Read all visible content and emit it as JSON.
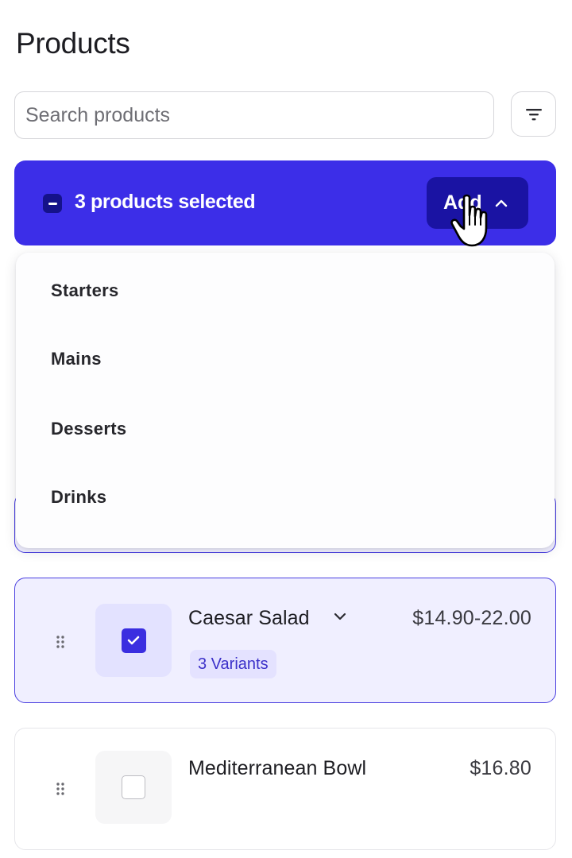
{
  "page": {
    "title": "Products"
  },
  "search": {
    "placeholder": "Search products",
    "value": ""
  },
  "filter": {
    "icon": "filter-icon"
  },
  "selection_bar": {
    "text": "3 products selected",
    "add_label": "Add",
    "add_icon": "chevron-up-icon",
    "background": "#3c2ee8"
  },
  "dropdown": {
    "items": [
      {
        "label": "Starters"
      },
      {
        "label": "Mains"
      },
      {
        "label": "Desserts"
      },
      {
        "label": "Drinks"
      }
    ]
  },
  "products": [
    {
      "name": "Caesar Salad",
      "price": "$14.90-22.00",
      "variants": "3 Variants",
      "selected": true
    },
    {
      "name": "Mediterranean Bowl",
      "price": "$16.80",
      "selected": false
    }
  ],
  "colors": {
    "accent": "#3c2ee8",
    "accent_dark": "#1a13a3",
    "selected_bg": "#f0efff"
  }
}
